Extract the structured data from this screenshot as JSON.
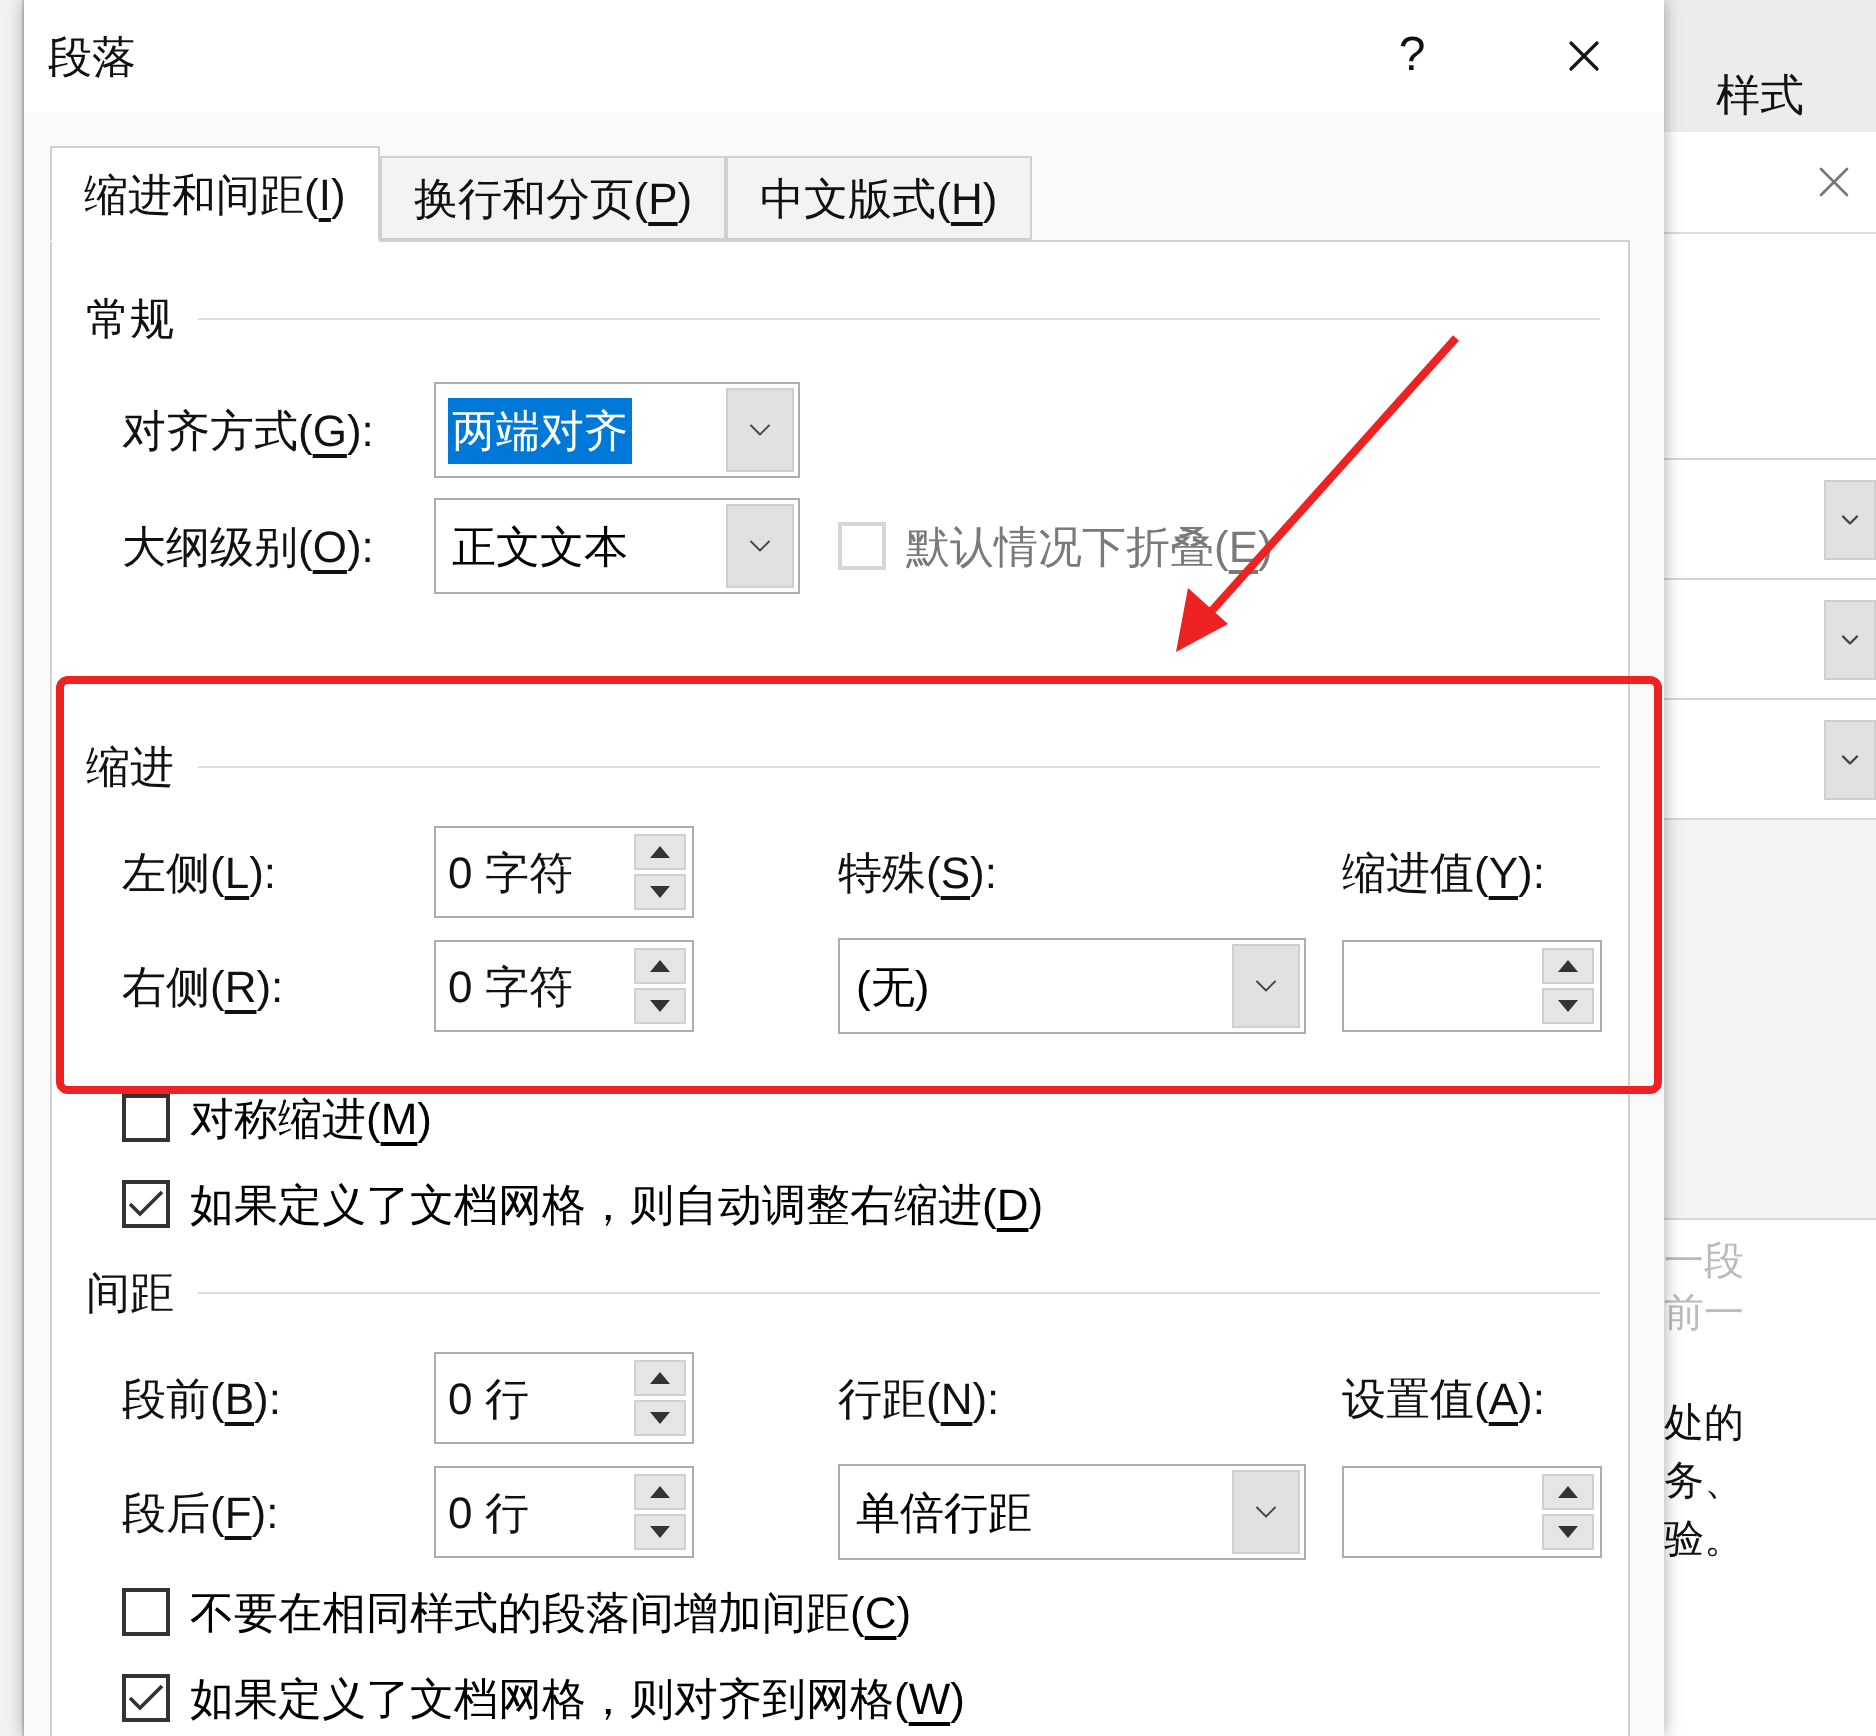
{
  "dialog": {
    "title": "段落",
    "help": "?"
  },
  "tabs": [
    {
      "before": "缩进和间距(",
      "key": "I",
      "after": ")",
      "selected": true
    },
    {
      "before": "换行和分页(",
      "key": "P",
      "after": ")",
      "selected": false
    },
    {
      "before": "中文版式(",
      "key": "H",
      "after": ")",
      "selected": false
    }
  ],
  "general": {
    "heading": "常规",
    "alignment": {
      "label": {
        "before": "对齐方式(",
        "key": "G",
        "after": "):"
      },
      "value": "两端对齐",
      "text_selected": true
    },
    "outline": {
      "label": {
        "before": "大纲级别(",
        "key": "O",
        "after": "):"
      },
      "value": "正文文本",
      "text_selected": false
    },
    "collapse": {
      "label": {
        "before": "默认情况下折叠(",
        "key": "E",
        "after": ")"
      },
      "checked": false,
      "disabled": true
    }
  },
  "indent": {
    "heading": "缩进",
    "left": {
      "label": {
        "before": "左侧(",
        "key": "L",
        "after": "):"
      },
      "value": "0 字符"
    },
    "right": {
      "label": {
        "before": "右侧(",
        "key": "R",
        "after": "):"
      },
      "value": "0 字符"
    },
    "special": {
      "label": {
        "before": "特殊(",
        "key": "S",
        "after": "):"
      },
      "value": "(无)"
    },
    "by": {
      "label": {
        "before": "缩进值(",
        "key": "Y",
        "after": "):"
      }
    },
    "options": [
      {
        "label": {
          "before": "对称缩进(",
          "key": "M",
          "after": ")"
        },
        "checked": false,
        "disabled": false
      },
      {
        "label": {
          "before": "如果定义了文档网格，则自动调整右缩进(",
          "key": "D",
          "after": ")"
        },
        "checked": true,
        "disabled": false
      }
    ]
  },
  "spacing": {
    "heading": "间距",
    "before": {
      "label": {
        "before": "段前(",
        "key": "B",
        "after": "):"
      },
      "value": "0 行"
    },
    "after": {
      "label": {
        "before": "段后(",
        "key": "F",
        "after": "):"
      },
      "value": "0 行"
    },
    "line": {
      "label": {
        "before": "行距(",
        "key": "N",
        "after": "):"
      },
      "value": "单倍行距"
    },
    "at": {
      "label": {
        "before": "设置值(",
        "key": "A",
        "after": "):"
      }
    },
    "options": [
      {
        "label": {
          "before": "不要在相同样式的段落间增加间距(",
          "key": "C",
          "after": ")"
        },
        "checked": false,
        "disabled": false
      },
      {
        "label": {
          "before": "如果定义了文档网格，则对齐到网格(",
          "key": "W",
          "after": ")"
        },
        "checked": true,
        "disabled": false
      }
    ]
  },
  "background_window": {
    "tab": "样式",
    "preview_faint": [
      "一段",
      "前一"
    ],
    "preview_text": [
      "处的",
      "务、",
      "验。"
    ]
  }
}
